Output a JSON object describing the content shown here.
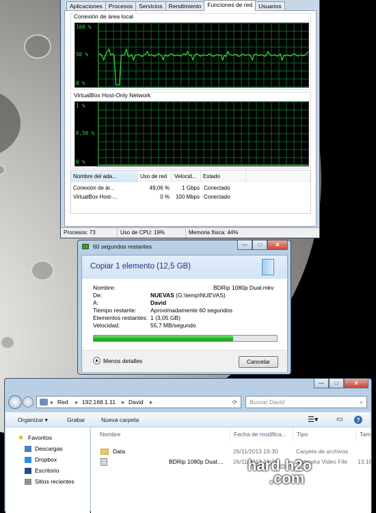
{
  "taskmgr": {
    "tabs": [
      "Aplicaciones",
      "Procesos",
      "Servicios",
      "Rendimiento",
      "Funciones de red",
      "Usuarios"
    ],
    "active_tab": "Funciones de red",
    "graph1": {
      "label": "Conexión de área local",
      "y_top": "100 %",
      "y_mid": "50 %",
      "y_bot": "0 %"
    },
    "graph2": {
      "label": "VirtualBox Host-Only Network",
      "y_top": "1 %",
      "y_mid": "0,50 %",
      "y_bot": "0 %"
    },
    "columns": [
      "Nombre del ada...",
      "Uso de red",
      "Velocid...",
      "Estado"
    ],
    "rows": [
      {
        "name": "Conexión de ár...",
        "usage": "49,06 %",
        "speed": "1 Gbps",
        "state": "Conectado"
      },
      {
        "name": "VirtualBox Host-...",
        "usage": "0 %",
        "speed": "100 Mbps",
        "state": "Conectado"
      }
    ],
    "status": {
      "processes": "Procesos: 73",
      "cpu": "Uso de CPU: 19%",
      "memory": "Memoria física: 44%"
    },
    "graph_color": "#3cd23c",
    "grid_color": "#0a6b2a"
  },
  "copy": {
    "title": "60 segundos restantes",
    "headline": "Copiar 1 elemento (12,5 GB)",
    "name_label": "Nombre:",
    "name_value": "BDRip 1080p Dual.mkv",
    "from_label": "De:",
    "from_bold": "NUEVAS",
    "from_rest": "(G:\\temp\\NUEVAS)",
    "to_label": "A:",
    "to_value": "David",
    "time_label": "Tiempo restante:",
    "time_value": "Aproximadamente 60 segundos",
    "items_label": "Elementos restantes:",
    "items_value": "1 (3,05 GB)",
    "speed_label": "Velocidad:",
    "speed_value": "55,7 MB/segundo",
    "progress_fraction": 0.76,
    "less_label": "Menos detalles",
    "cancel_label": "Cancelar"
  },
  "explorer": {
    "address": [
      "Red",
      "192.168.1.11",
      "David"
    ],
    "search_placeholder": "Buscar David",
    "toolbar": {
      "organize": "Organizar ▾",
      "burn": "Grabar",
      "new_folder": "Nueva carpeta"
    },
    "nav": {
      "favorites": "Favoritos",
      "items": [
        "Descargas",
        "Dropbox",
        "Escritorio",
        "Sitios recientes"
      ]
    },
    "columns": [
      "Nombre",
      "Fecha de modifica...",
      "Tipo",
      "Tam"
    ],
    "files": [
      {
        "name": "Data",
        "date": "26/11/2013 19:30",
        "type": "Carpeta de archivos",
        "size": ""
      },
      {
        "name": "BDRip 1080p Dual....",
        "date": "26/11/2013 19:30",
        "type": "Matroska Video File",
        "size": "13.18"
      }
    ]
  },
  "watermark": {
    "line1": "hard-h2o",
    "line2": ".com"
  }
}
